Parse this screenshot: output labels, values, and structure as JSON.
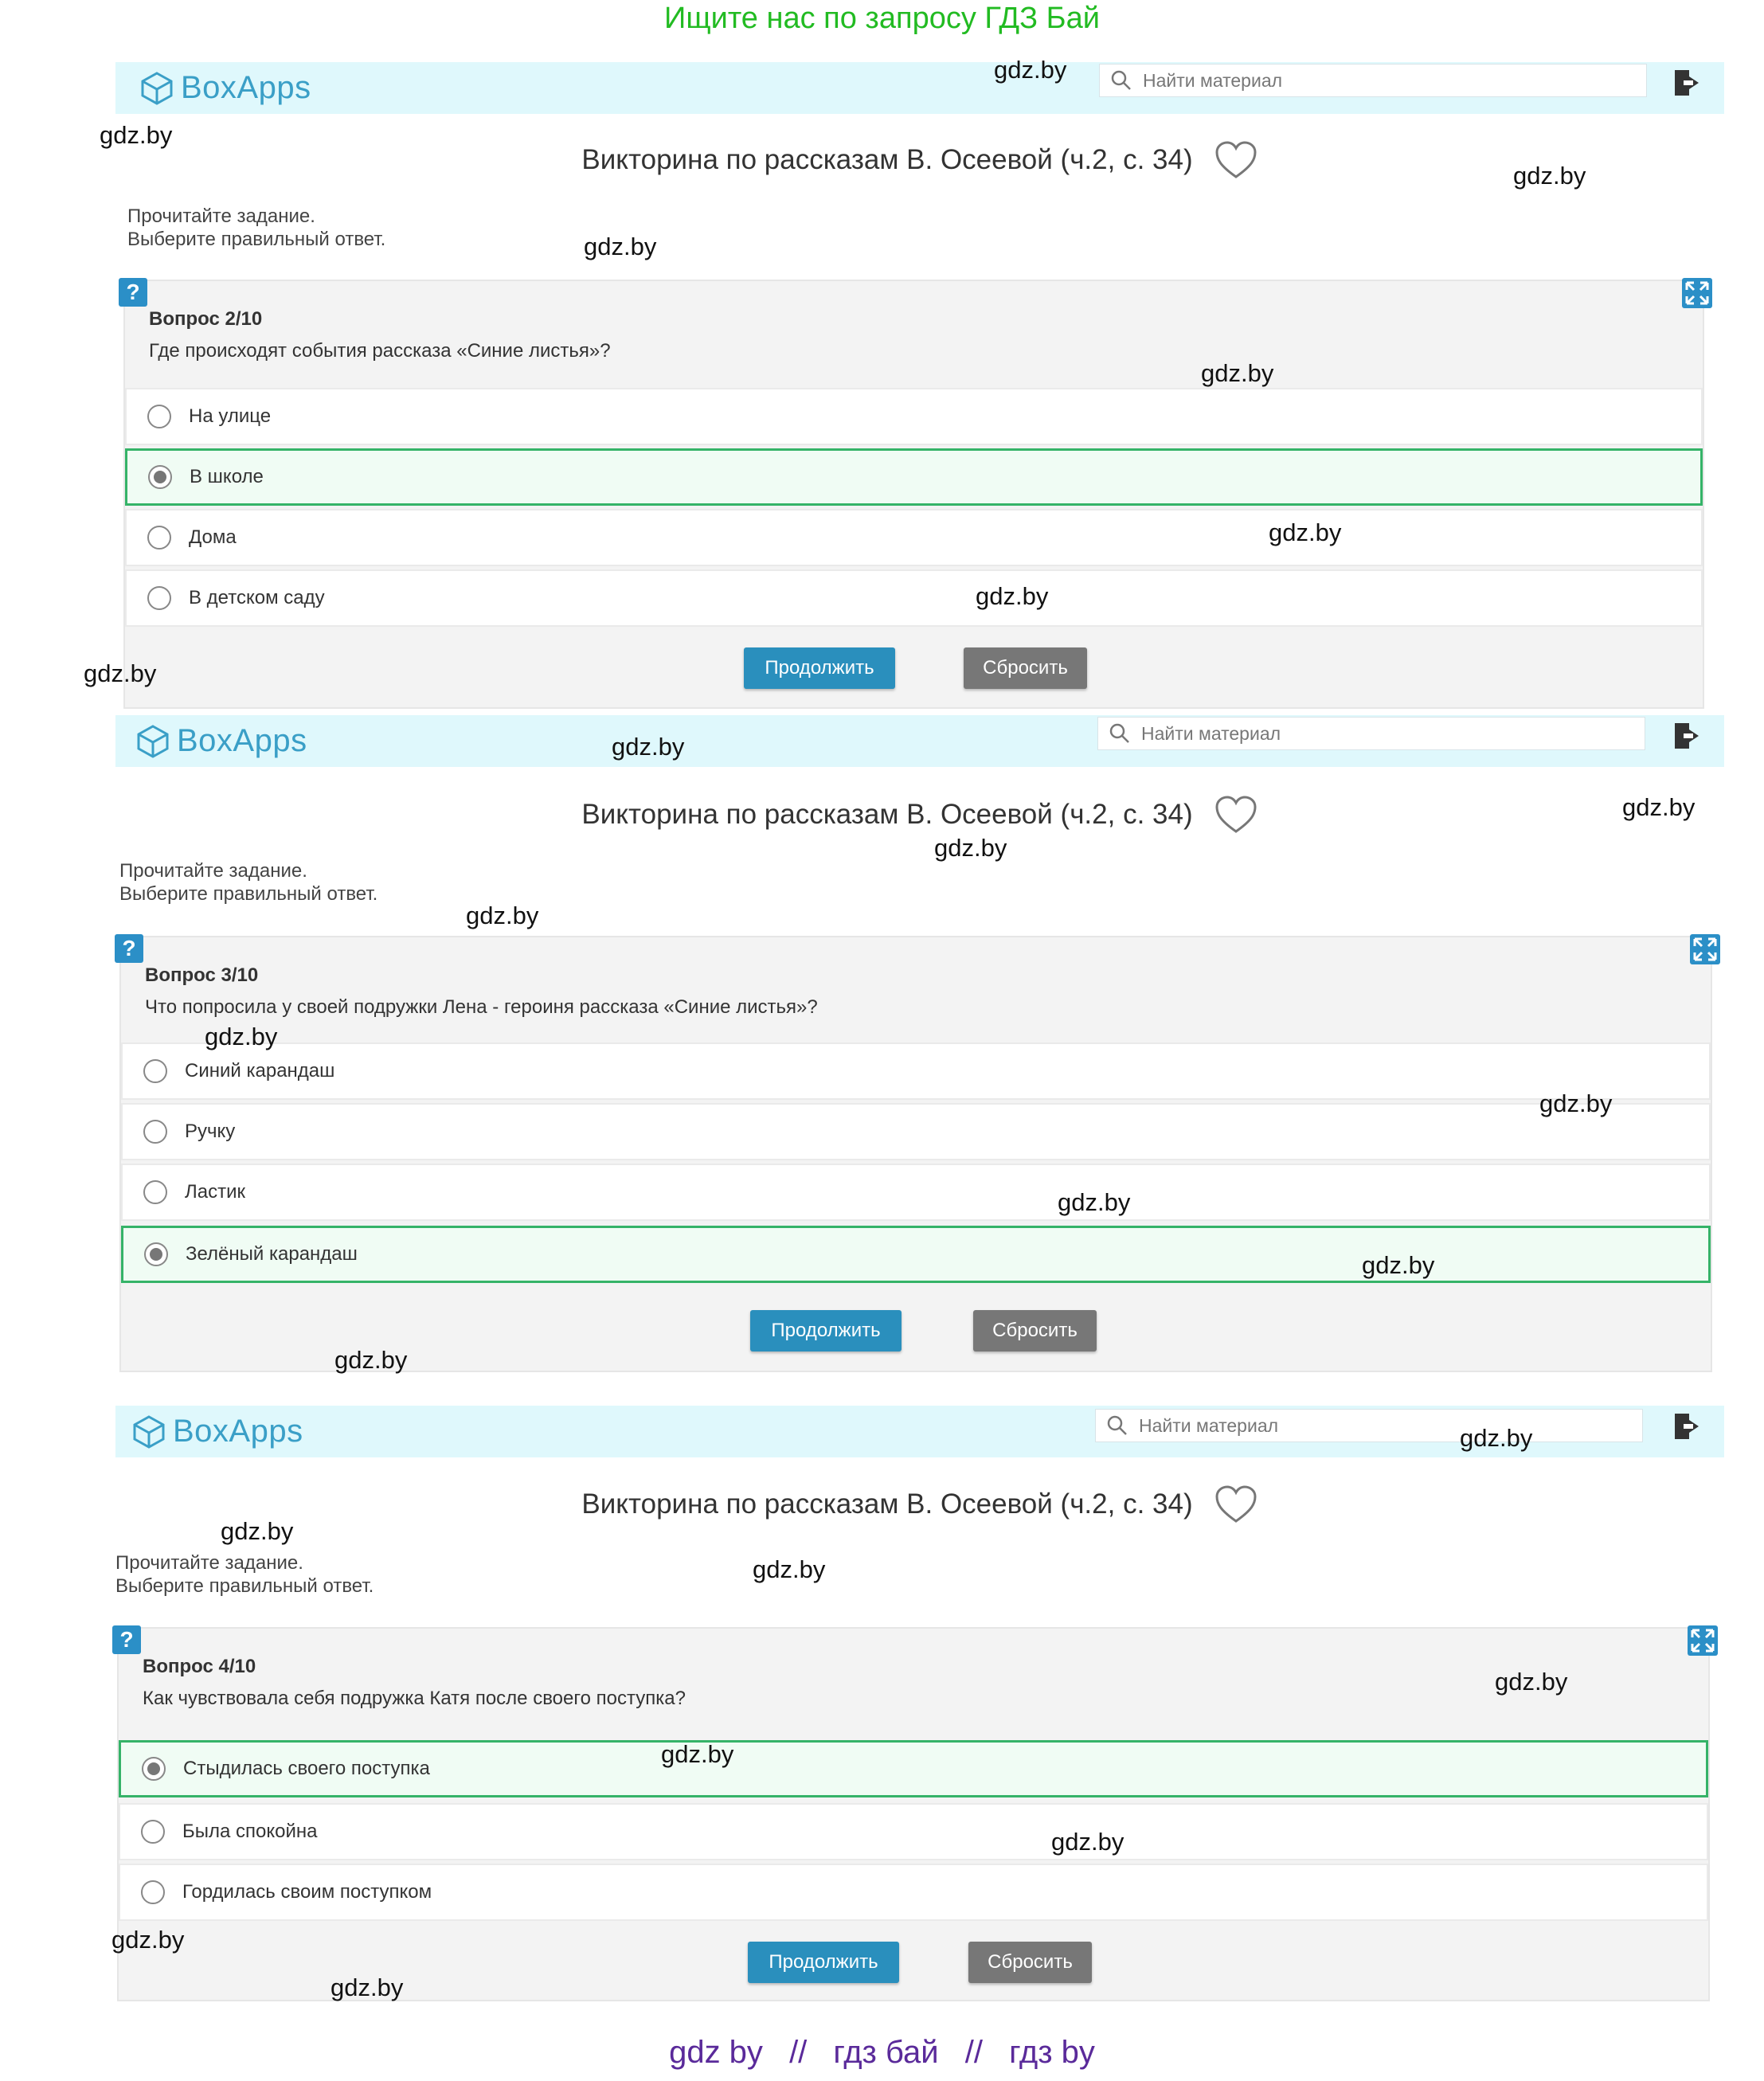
{
  "banner_top": "Ищите нас по запросу ГДЗ Бай",
  "banner_bottom": [
    "gdz by",
    "//",
    "гдз бай",
    "//",
    "гдз by"
  ],
  "brand": "BoxApps",
  "search_placeholder": "Найти материал",
  "quiz_title": "Викторина по рассказам В. Осеевой (ч.2, с. 34)",
  "instruction": {
    "line1": "Прочитайте задание.",
    "line2": "Выберите правильный ответ."
  },
  "buttons": {
    "continue": "Продолжить",
    "reset": "Сбросить"
  },
  "panels": [
    {
      "qnum": "Вопрос 2/10",
      "question": "Где происходят события рассказа «Синие листья»?",
      "options": [
        {
          "label": "На улице",
          "selected": false
        },
        {
          "label": "В школе",
          "selected": true
        },
        {
          "label": "Дома",
          "selected": false
        },
        {
          "label": "В детском саду",
          "selected": false
        }
      ]
    },
    {
      "qnum": "Вопрос 3/10",
      "question": "Что попросила у своей подружки Лена - героиня рассказа «Синие листья»?",
      "options": [
        {
          "label": "Синий карандаш",
          "selected": false
        },
        {
          "label": "Ручку",
          "selected": false
        },
        {
          "label": "Ластик",
          "selected": false
        },
        {
          "label": "Зелёный карандаш",
          "selected": true
        }
      ]
    },
    {
      "qnum": "Вопрос 4/10",
      "question": "Как чувствовала себя подружка Катя после своего поступка?",
      "options": [
        {
          "label": "Стыдилась своего поступка",
          "selected": true
        },
        {
          "label": "Была спокойна",
          "selected": false
        },
        {
          "label": "Гордилась своим поступком",
          "selected": false
        }
      ]
    }
  ],
  "watermark": "gdz.by"
}
